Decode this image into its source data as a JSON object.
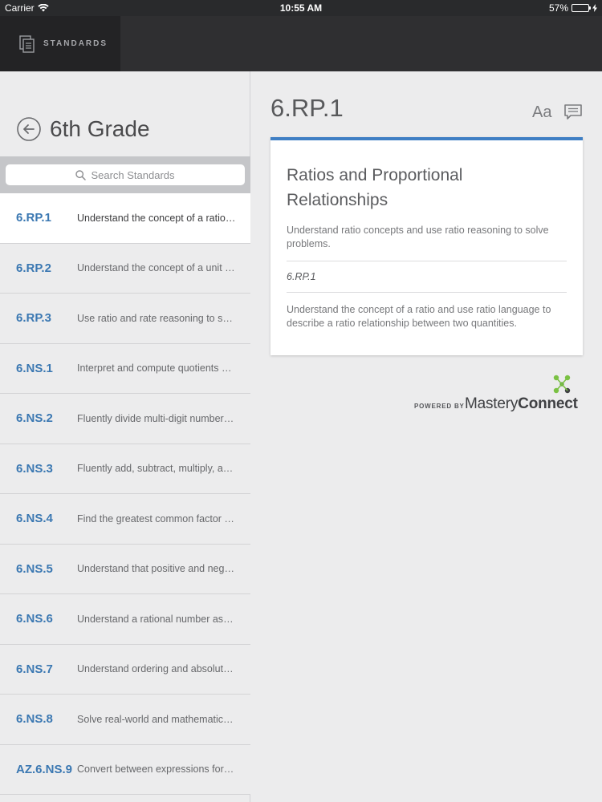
{
  "status_bar": {
    "carrier": "Carrier",
    "time": "10:55 AM",
    "battery": "57%"
  },
  "app_bar": {
    "tab_label": "STANDARDS"
  },
  "left": {
    "grade_title": "6th Grade",
    "search_placeholder": "Search Standards",
    "standards": [
      {
        "code": "6.RP.1",
        "desc": "Understand the concept of a ratio and use ratio language",
        "selected": true
      },
      {
        "code": "6.RP.2",
        "desc": "Understand the concept of a unit rate a/b associated",
        "selected": false
      },
      {
        "code": "6.RP.3",
        "desc": "Use ratio and rate reasoning to solve real-world",
        "selected": false
      },
      {
        "code": "6.NS.1",
        "desc": "Interpret and compute quotients of fractions",
        "selected": false
      },
      {
        "code": "6.NS.2",
        "desc": "Fluently divide multi-digit numbers using the standard",
        "selected": false
      },
      {
        "code": "6.NS.3",
        "desc": "Fluently add, subtract, multiply, and divide",
        "selected": false
      },
      {
        "code": "6.NS.4",
        "desc": "Find the greatest common factor of two whole numbers",
        "selected": false
      },
      {
        "code": "6.NS.5",
        "desc": "Understand that positive and negative numbers",
        "selected": false
      },
      {
        "code": "6.NS.6",
        "desc": "Understand a rational number as a point on the",
        "selected": false
      },
      {
        "code": "6.NS.7",
        "desc": "Understand ordering and absolute value of rational",
        "selected": false
      },
      {
        "code": "6.NS.8",
        "desc": "Solve real-world and mathematical problems by",
        "selected": false
      },
      {
        "code": "AZ.6.NS.9",
        "desc": "Convert between expressions for positive rational",
        "selected": false
      }
    ]
  },
  "detail": {
    "code_title": "6.RP.1",
    "font_button": "Aa",
    "card": {
      "title": "Ratios and Proportional Relationships",
      "subtitle": "Understand ratio concepts and use ratio reasoning to solve problems.",
      "code": "6.RP.1",
      "description": "Understand the concept of a ratio and use ratio language to describe a ratio relationship between two quantities."
    },
    "powered_by": "POWERED BY",
    "brand_light": "Mastery",
    "brand_bold": "Connect"
  },
  "colors": {
    "accent": "#3f7fc4",
    "code_blue": "#3b78b2",
    "logo_green": "#7ac143"
  }
}
